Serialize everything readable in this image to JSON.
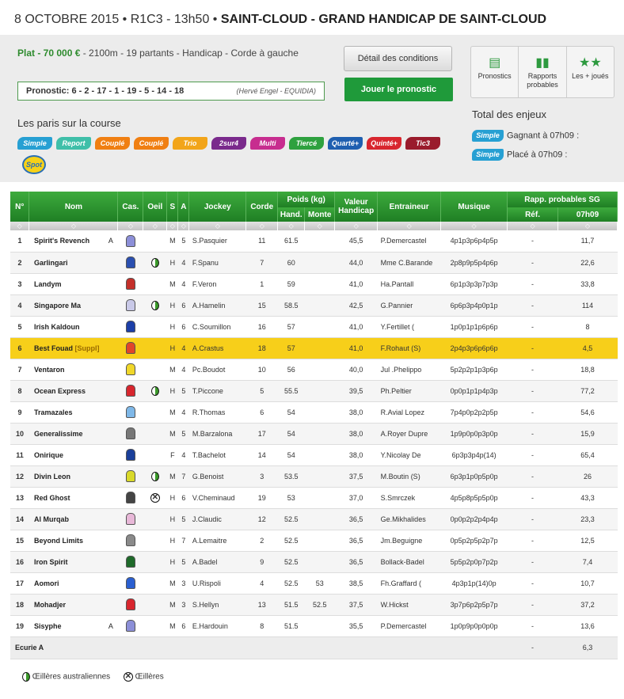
{
  "header": {
    "date": "8 OCTOBRE 2015",
    "reunion": "R1C3",
    "time": "13h50",
    "title": "SAINT-CLOUD - GRAND HANDICAP DE SAINT-CLOUD"
  },
  "specs": {
    "discipline": "Plat - 70 000 €",
    "details": " - 2100m - 19 partants  - Handicap  - Corde à gauche"
  },
  "pronostic": {
    "label": "Pronostic: 6 - 2 - 17 - 1 - 19 - 5 - 14 - 18",
    "author": "(Hervé Engel - EQUIDIA)"
  },
  "buttons": {
    "conditions": "Détail des conditions",
    "jouer": "Jouer le pronostic"
  },
  "paris": {
    "title": "Les paris sur la course",
    "bets": [
      {
        "label": "Simple",
        "color": "#27a0d3"
      },
      {
        "label": "Report",
        "color": "#3fbfa9"
      },
      {
        "label": "Couplé",
        "color": "#f07f12"
      },
      {
        "label": "Couplé",
        "color": "#f07f12"
      },
      {
        "label": "Trio",
        "color": "#f2a51a"
      },
      {
        "label": "2sur4",
        "color": "#7a2a8c"
      },
      {
        "label": "Multi",
        "color": "#c72d8f"
      },
      {
        "label": "Tiercé",
        "color": "#2ea13f"
      },
      {
        "label": "Quarté+",
        "color": "#1f5fb0"
      },
      {
        "label": "Quinté+",
        "color": "#d8262e"
      },
      {
        "label": "Tic3",
        "color": "#9a1b2c"
      }
    ],
    "spot": "Spot"
  },
  "tools": [
    {
      "label": "Pronostics",
      "icon": "clipboard-icon"
    },
    {
      "label": "Rapports probables",
      "icon": "bar-chart-icon"
    },
    {
      "label": "Les + joués",
      "icon": "stars-icon"
    }
  ],
  "enjeux": {
    "title": "Total des enjeux",
    "rows": [
      {
        "badge": "Simple",
        "text": "Gagnant à 07h09 :"
      },
      {
        "badge": "Simple",
        "text": "Placé à 07h09 :"
      }
    ]
  },
  "table": {
    "headers": {
      "num": "N°",
      "nom": "Nom",
      "cas": "Cas.",
      "oeil": "Oeil",
      "s": "S",
      "a": "A",
      "jockey": "Jockey",
      "corde": "Corde",
      "poids": "Poids (kg)",
      "hand": "Hand.",
      "monte": "Monte",
      "valeur": "Valeur Handicap",
      "entraineur": "Entraineur",
      "musique": "Musique",
      "rapp": "Rapp. probables SG",
      "ref": "Réf.",
      "heure": "07h09"
    },
    "sort_glyph": "◇",
    "rows": [
      {
        "num": "1",
        "nom": "Spirit's Revench",
        "tag": "A",
        "silk": "#8c8fd8",
        "oeil": "",
        "s": "M",
        "a": "5",
        "jockey": "S.Pasquier",
        "corde": "11",
        "hand": "61.5",
        "monte": "",
        "valeur": "45,5",
        "entraineur": "P.Demercastel",
        "musique": "4p1p3p6p4p5p",
        "ref": "-",
        "rapp": "11,7"
      },
      {
        "num": "2",
        "nom": "Garlingari",
        "tag": "",
        "silk": "#2a4fb0",
        "oeil": "A",
        "s": "H",
        "a": "4",
        "jockey": "F.Spanu",
        "corde": "7",
        "hand": "60",
        "monte": "",
        "valeur": "44,0",
        "entraineur": "Mme C.Barande",
        "musique": "2p8p9p5p4p6p",
        "ref": "-",
        "rapp": "22,6"
      },
      {
        "num": "3",
        "nom": "Landym",
        "tag": "",
        "silk": "#c4302a",
        "oeil": "",
        "s": "M",
        "a": "4",
        "jockey": "F.Veron",
        "corde": "1",
        "hand": "59",
        "monte": "",
        "valeur": "41,0",
        "entraineur": "Ha.Pantall",
        "musique": "6p1p3p3p7p3p",
        "ref": "-",
        "rapp": "33,8"
      },
      {
        "num": "4",
        "nom": "Singapore Ma",
        "tag": "",
        "silk": "#c9c9e8",
        "oeil": "A",
        "s": "H",
        "a": "6",
        "jockey": "A.Hamelin",
        "corde": "15",
        "hand": "58.5",
        "monte": "",
        "valeur": "42,5",
        "entraineur": "G.Pannier",
        "musique": "6p6p3p4p0p1p",
        "ref": "-",
        "rapp": "114"
      },
      {
        "num": "5",
        "nom": "Irish Kaldoun",
        "tag": "",
        "silk": "#1c3fa8",
        "oeil": "",
        "s": "H",
        "a": "6",
        "jockey": "C.Soumillon",
        "corde": "16",
        "hand": "57",
        "monte": "",
        "valeur": "41,0",
        "entraineur": "Y.Fertillet (",
        "musique": "1p0p1p1p6p6p",
        "ref": "-",
        "rapp": "8"
      },
      {
        "num": "6",
        "nom": "Best Fouad",
        "tag": "[Suppl]",
        "silk": "#e0452a",
        "oeil": "",
        "s": "H",
        "a": "4",
        "jockey": "A.Crastus",
        "corde": "18",
        "hand": "57",
        "monte": "",
        "valeur": "41,0",
        "entraineur": "F.Rohaut (S)",
        "musique": "2p4p3p6p6p6p",
        "ref": "-",
        "rapp": "4,5"
      },
      {
        "num": "7",
        "nom": "Ventaron",
        "tag": "",
        "silk": "#f0d72a",
        "oeil": "",
        "s": "M",
        "a": "4",
        "jockey": "Pc.Boudot",
        "corde": "10",
        "hand": "56",
        "monte": "",
        "valeur": "40,0",
        "entraineur": "Jul .Phelippo",
        "musique": "5p2p2p1p3p6p",
        "ref": "-",
        "rapp": "18,8"
      },
      {
        "num": "8",
        "nom": "Ocean Express",
        "tag": "",
        "silk": "#d8262e",
        "oeil": "A",
        "s": "H",
        "a": "5",
        "jockey": "T.Piccone",
        "corde": "5",
        "hand": "55.5",
        "monte": "",
        "valeur": "39,5",
        "entraineur": "Ph.Peltier",
        "musique": "0p0p1p1p4p3p",
        "ref": "-",
        "rapp": "77,2"
      },
      {
        "num": "9",
        "nom": "Tramazales",
        "tag": "",
        "silk": "#7fb8e8",
        "oeil": "",
        "s": "M",
        "a": "4",
        "jockey": "R.Thomas",
        "corde": "6",
        "hand": "54",
        "monte": "",
        "valeur": "38,0",
        "entraineur": "R.Avial Lopez",
        "musique": "7p4p0p2p2p5p",
        "ref": "-",
        "rapp": "54,6"
      },
      {
        "num": "10",
        "nom": "Generalissime",
        "tag": "",
        "silk": "#777777",
        "oeil": "",
        "s": "M",
        "a": "5",
        "jockey": "M.Barzalona",
        "corde": "17",
        "hand": "54",
        "monte": "",
        "valeur": "38,0",
        "entraineur": "A.Royer Dupre",
        "musique": "1p9p0p0p3p0p",
        "ref": "-",
        "rapp": "15,9"
      },
      {
        "num": "11",
        "nom": "Onirique",
        "tag": "",
        "silk": "#1a3f9a",
        "oeil": "",
        "s": "F",
        "a": "4",
        "jockey": "T.Bachelot",
        "corde": "14",
        "hand": "54",
        "monte": "",
        "valeur": "38,0",
        "entraineur": "Y.Nicolay De",
        "musique": "6p3p3p4p(14)",
        "ref": "-",
        "rapp": "65,4"
      },
      {
        "num": "12",
        "nom": "Divin Leon",
        "tag": "",
        "silk": "#d9d92a",
        "oeil": "A",
        "s": "M",
        "a": "7",
        "jockey": "G.Benoist",
        "corde": "3",
        "hand": "53.5",
        "monte": "",
        "valeur": "37,5",
        "entraineur": "M.Boutin (S)",
        "musique": "6p3p1p0p5p0p",
        "ref": "-",
        "rapp": "26"
      },
      {
        "num": "13",
        "nom": "Red Ghost",
        "tag": "",
        "silk": "#444444",
        "oeil": "X",
        "s": "H",
        "a": "6",
        "jockey": "V.Cheminaud",
        "corde": "19",
        "hand": "53",
        "monte": "",
        "valeur": "37,0",
        "entraineur": "S.Smrczek",
        "musique": "4p5p8p5p5p0p",
        "ref": "-",
        "rapp": "43,3"
      },
      {
        "num": "14",
        "nom": "Al Murqab",
        "tag": "",
        "silk": "#e8b8d8",
        "oeil": "",
        "s": "H",
        "a": "5",
        "jockey": "J.Claudic",
        "corde": "12",
        "hand": "52.5",
        "monte": "",
        "valeur": "36,5",
        "entraineur": "Ge.Mikhalides",
        "musique": "0p0p2p2p4p4p",
        "ref": "-",
        "rapp": "23,3"
      },
      {
        "num": "15",
        "nom": "Beyond Limits",
        "tag": "",
        "silk": "#8a8a8a",
        "oeil": "",
        "s": "H",
        "a": "7",
        "jockey": "A.Lemaitre",
        "corde": "2",
        "hand": "52.5",
        "monte": "",
        "valeur": "36,5",
        "entraineur": "Jm.Beguigne",
        "musique": "0p5p2p5p2p7p",
        "ref": "-",
        "rapp": "12,5"
      },
      {
        "num": "16",
        "nom": "Iron Spirit",
        "tag": "",
        "silk": "#1f6a2a",
        "oeil": "",
        "s": "H",
        "a": "5",
        "jockey": "A.Badel",
        "corde": "9",
        "hand": "52.5",
        "monte": "",
        "valeur": "36,5",
        "entraineur": "Bollack-Badel",
        "musique": "5p5p2p0p7p2p",
        "ref": "-",
        "rapp": "7,4"
      },
      {
        "num": "17",
        "nom": "Aomori",
        "tag": "",
        "silk": "#2a5fd0",
        "oeil": "",
        "s": "M",
        "a": "3",
        "jockey": "U.Rispoli",
        "corde": "4",
        "hand": "52.5",
        "monte": "53",
        "valeur": "38,5",
        "entraineur": "Fh.Graffard (",
        "musique": "4p3p1p(14)0p",
        "ref": "-",
        "rapp": "10,7"
      },
      {
        "num": "18",
        "nom": "Mohadjer",
        "tag": "",
        "silk": "#d8262e",
        "oeil": "",
        "s": "M",
        "a": "3",
        "jockey": "S.Hellyn",
        "corde": "13",
        "hand": "51.5",
        "monte": "52.5",
        "valeur": "37,5",
        "entraineur": "W.Hickst",
        "musique": "3p7p6p2p5p7p",
        "ref": "-",
        "rapp": "37,2"
      },
      {
        "num": "19",
        "nom": "Sisyphe",
        "tag": "A",
        "silk": "#8c8fd8",
        "oeil": "",
        "s": "M",
        "a": "6",
        "jockey": "E.Hardouin",
        "corde": "8",
        "hand": "51.5",
        "monte": "",
        "valeur": "35,5",
        "entraineur": "P.Demercastel",
        "musique": "1p0p9p0p0p0p",
        "ref": "-",
        "rapp": "13,6"
      }
    ],
    "ecurie": {
      "label": "Ecurie A",
      "ref": "-",
      "rapp": "6,3"
    }
  },
  "legend": {
    "aus": "Œillères australiennes",
    "oeil": "Œillères"
  }
}
